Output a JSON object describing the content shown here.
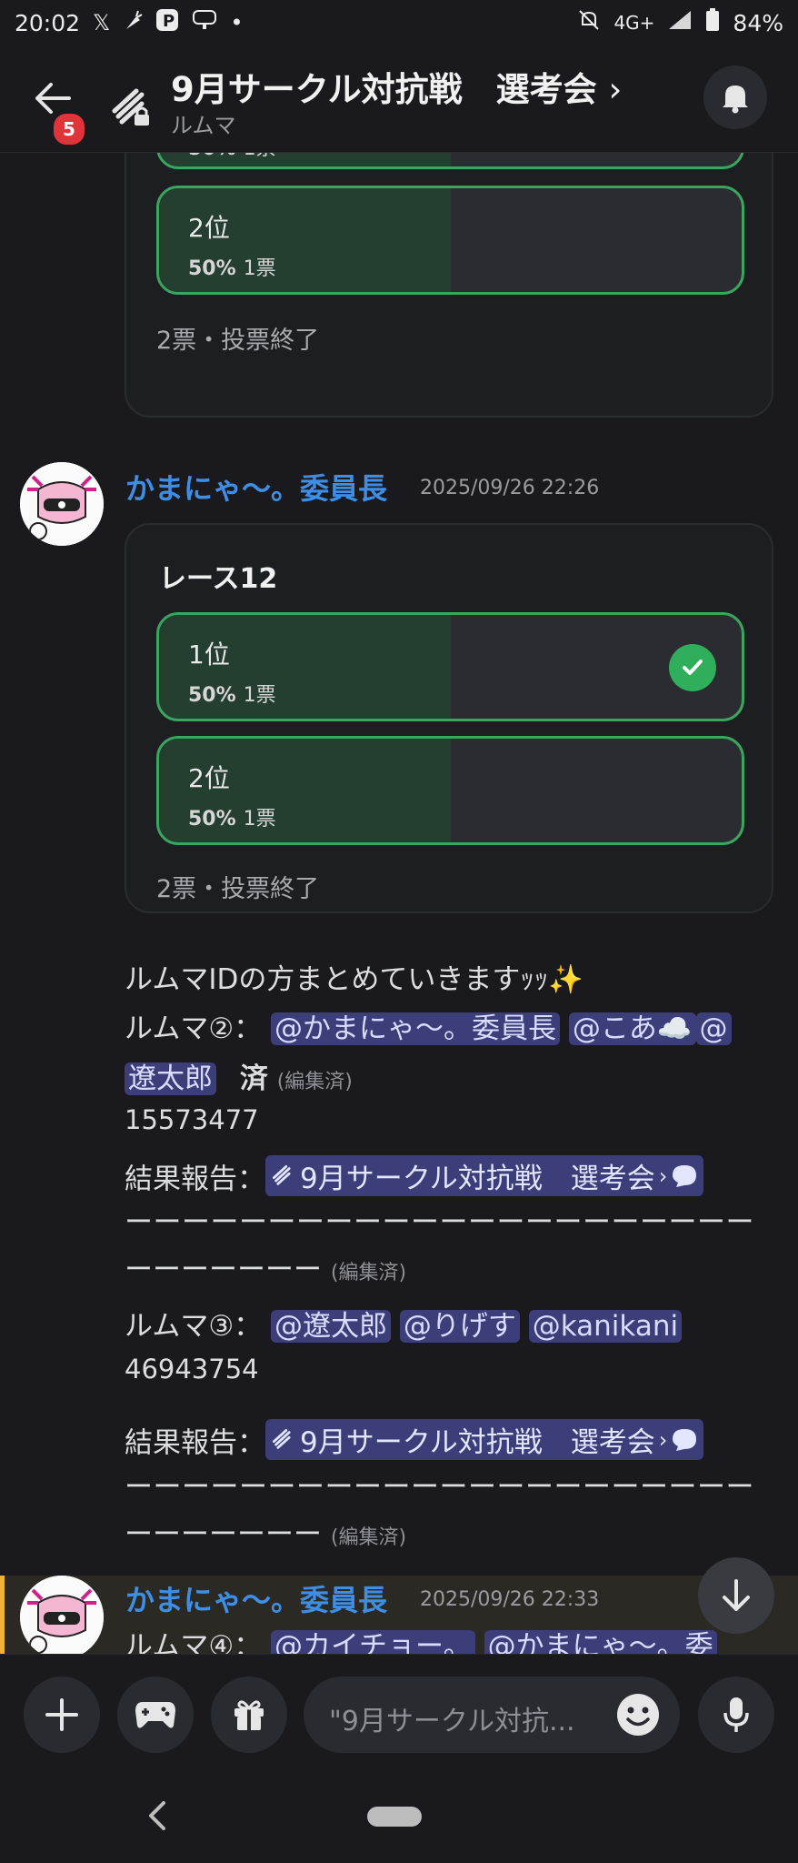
{
  "status_bar": {
    "time": "20:02",
    "network": "4G+",
    "battery": "84%"
  },
  "header": {
    "back_badge": "5",
    "title": "9月サークル対抗戦　選考会",
    "title_chevron": "›",
    "subtitle": "ルムマ"
  },
  "poll_top": {
    "partial_option": {
      "percent": "50%",
      "votes": "1票",
      "fill_fraction": 0.5
    },
    "option2": {
      "label": "2位",
      "percent": "50%",
      "votes": "1票",
      "fill_fraction": 0.5
    },
    "footer": "2票・投票終了"
  },
  "message1": {
    "author": "かまにゃ〜。委員長",
    "timestamp": "2025/09/26 22:26",
    "poll": {
      "question": "レース12",
      "options": [
        {
          "label": "1位",
          "percent": "50%",
          "votes": "1票",
          "fill_fraction": 0.5,
          "checked": true
        },
        {
          "label": "2位",
          "percent": "50%",
          "votes": "1票",
          "fill_fraction": 0.5,
          "checked": false
        }
      ],
      "footer": "2票・投票終了"
    },
    "lines": {
      "intro": "ルムマIDの方まとめていきますｯｯ✨",
      "r2_prefix": "ルムマ②：",
      "r2_mention1": "@かまにゃ〜。委員長",
      "r2_mention2": "@こあ☁️",
      "r2_mention3a": "@",
      "r2_mention3b": "遼太郎",
      "r2_done": "済",
      "edited": "(編集済)",
      "r2_id": "15573477",
      "report_prefix": "結果報告：",
      "report_link": "9月サークル対抗戦　選考会",
      "dashes": "ーーーーーーーーーーーーーーーーーーーーーー",
      "dashes_short": "ーーーーーーー",
      "r3_prefix": "ルムマ③：",
      "r3_mention1": "@遼太郎",
      "r3_mention2": "@りげす",
      "r3_mention3": "@kanikani",
      "r3_id": "46943754"
    }
  },
  "message2": {
    "author": "かまにゃ〜。委員長",
    "timestamp": "2025/09/26 22:33",
    "r4_prefix": "ルムマ④：",
    "r4_mention1": "@カイチョー。",
    "r4_mention2": "@かまにゃ〜。委"
  },
  "composer": {
    "placeholder": "\"9月サークル対抗..."
  },
  "icons": [
    "back-arrow-icon",
    "forum-channel-icon",
    "bell-icon",
    "plus-icon",
    "gamepad-icon",
    "gift-icon",
    "emoji-icon",
    "microphone-icon",
    "arrow-down-icon",
    "checkmark-icon",
    "thread-bubble-icon"
  ],
  "colors": {
    "accent_green": "#3ba55d",
    "mention_bg": "#3c3e7a",
    "author_blue": "#3f8ee6",
    "badge_red": "#e0343a",
    "highlight_bar": "#f0b232"
  }
}
